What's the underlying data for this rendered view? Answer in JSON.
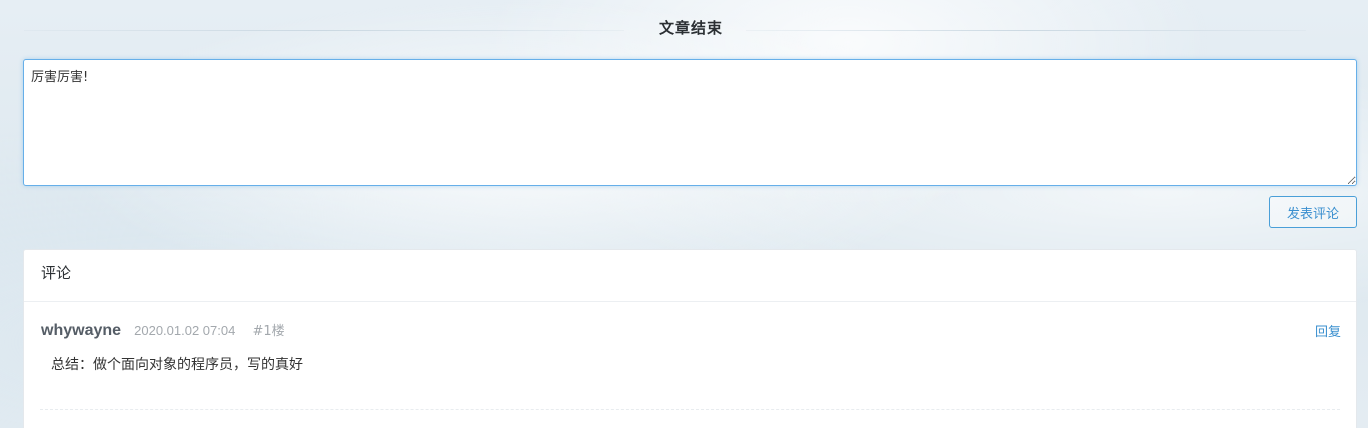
{
  "article_end": {
    "title": "文章结束"
  },
  "comment_form": {
    "input_value": "厉害厉害!",
    "submit_label": "发表评论"
  },
  "comments": {
    "header": "评论",
    "items": [
      {
        "author": "whywayne",
        "time": "2020.01.02 07:04",
        "floor": "#1楼",
        "reply_label": "回复",
        "content": "总结：做个面向对象的程序员，写的真好"
      }
    ]
  },
  "colors": {
    "accent": "#3a8fcf",
    "input_focus_border": "#66afe9",
    "author": "#555d66",
    "meta": "#a3a8ad"
  }
}
